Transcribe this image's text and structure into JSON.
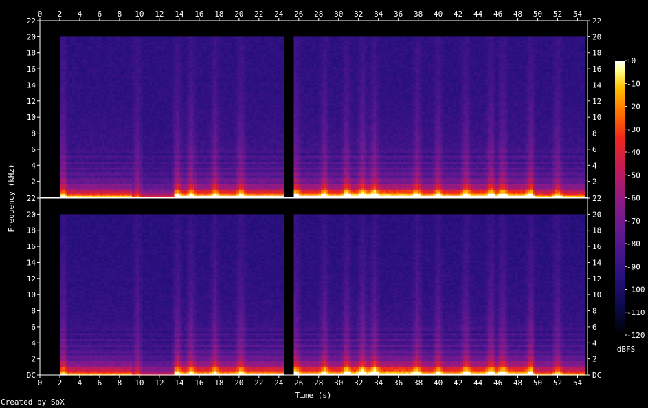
{
  "chart_data": {
    "type": "heatmap",
    "xlabel": "Time (s)",
    "ylabel": "Frequency (kHz)",
    "xlim": [
      0,
      55
    ],
    "ylim": [
      0,
      22
    ],
    "x_ticks": [
      "0",
      "2",
      "4",
      "6",
      "8",
      "10",
      "12",
      "14",
      "16",
      "18",
      "20",
      "22",
      "24",
      "26",
      "28",
      "30",
      "32",
      "34",
      "36",
      "38",
      "40",
      "42",
      "44",
      "46",
      "48",
      "50",
      "52",
      "54"
    ],
    "y_ticks_top": [
      "22",
      "20",
      "18",
      "16",
      "14",
      "12",
      "10",
      "8",
      "6",
      "4",
      "2"
    ],
    "y_ticks_bottom": [
      "22",
      "20",
      "18",
      "16",
      "14",
      "12",
      "10",
      "8",
      "6",
      "4",
      "2",
      "DC"
    ],
    "channels": 2,
    "colorbar": {
      "label": "dBFS",
      "ticks": [
        "+0",
        "-10",
        "-20",
        "-30",
        "-40",
        "-50",
        "-60",
        "-70",
        "-80",
        "-90",
        "-100",
        "-110",
        "-120"
      ],
      "range": [
        -120,
        0
      ]
    },
    "signal_end_khz": 20,
    "audio_start_s": 2.1,
    "audio_end_s": 54.8,
    "gaps_s": [
      [
        24.6,
        25.6
      ]
    ],
    "loud_segments": [
      {
        "start": 2.1,
        "end": 9.2,
        "level": 0.72
      },
      {
        "start": 9.2,
        "end": 13.6,
        "level": 0.45
      },
      {
        "start": 13.6,
        "end": 24.6,
        "level": 0.82
      },
      {
        "start": 25.6,
        "end": 30.6,
        "level": 0.86
      },
      {
        "start": 30.6,
        "end": 37.8,
        "level": 0.95
      },
      {
        "start": 37.8,
        "end": 42.6,
        "level": 0.84
      },
      {
        "start": 42.6,
        "end": 49.6,
        "level": 0.9
      },
      {
        "start": 49.6,
        "end": 54.8,
        "level": 0.7
      }
    ],
    "transients_s": [
      2.3,
      9.8,
      13.8,
      15.2,
      17.6,
      20.2,
      25.7,
      28.6,
      30.8,
      32.4,
      33.6,
      37.9,
      40.0,
      42.8,
      45.3,
      46.5,
      49.3,
      52.0
    ]
  },
  "footer": {
    "credit": "Created by SoX"
  }
}
